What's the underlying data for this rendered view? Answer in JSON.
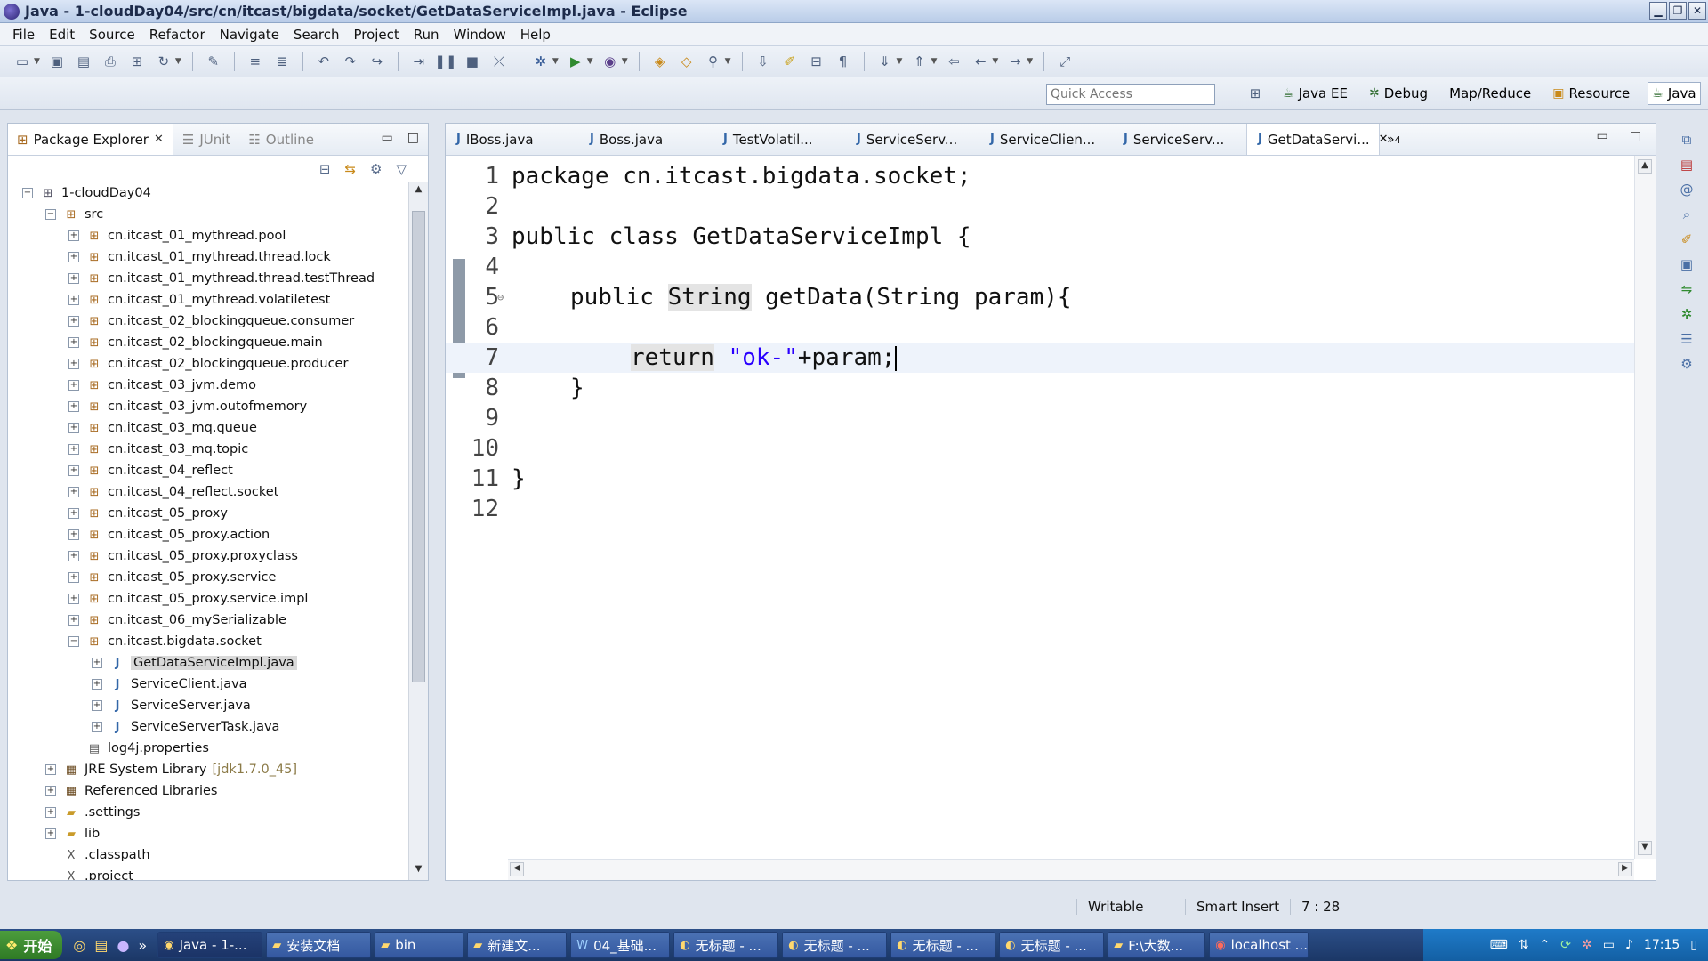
{
  "window": {
    "title": "Java - 1-cloudDay04/src/cn/itcast/bigdata/socket/GetDataServiceImpl.java - Eclipse"
  },
  "menu": [
    "File",
    "Edit",
    "Source",
    "Refactor",
    "Navigate",
    "Search",
    "Project",
    "Run",
    "Window",
    "Help"
  ],
  "quick_access": {
    "placeholder": "Quick Access"
  },
  "perspectives": [
    {
      "label": "Java EE",
      "icon": "java-ee-icon"
    },
    {
      "label": "Debug",
      "icon": "debug-icon"
    },
    {
      "label": "Map/Reduce",
      "icon": ""
    },
    {
      "label": "Resource",
      "icon": "resource-icon"
    },
    {
      "label": "Java",
      "icon": "java-perspective-icon",
      "active": true
    }
  ],
  "left_view": {
    "tabs": [
      "Package Explorer",
      "JUnit",
      "Outline"
    ],
    "tree": [
      {
        "label": "1-cloudDay04",
        "type": "project",
        "depth": 0,
        "expanded": true
      },
      {
        "label": "src",
        "type": "srcfolder",
        "depth": 1,
        "expanded": true
      },
      {
        "label": "cn.itcast_01_mythread.pool",
        "type": "package",
        "depth": 2
      },
      {
        "label": "cn.itcast_01_mythread.thread.lock",
        "type": "package",
        "depth": 2
      },
      {
        "label": "cn.itcast_01_mythread.thread.testThread",
        "type": "package",
        "depth": 2
      },
      {
        "label": "cn.itcast_01_mythread.volatiletest",
        "type": "package",
        "depth": 2
      },
      {
        "label": "cn.itcast_02_blockingqueue.consumer",
        "type": "package",
        "depth": 2
      },
      {
        "label": "cn.itcast_02_blockingqueue.main",
        "type": "package",
        "depth": 2
      },
      {
        "label": "cn.itcast_02_blockingqueue.producer",
        "type": "package",
        "depth": 2
      },
      {
        "label": "cn.itcast_03_jvm.demo",
        "type": "package",
        "depth": 2
      },
      {
        "label": "cn.itcast_03_jvm.outofmemory",
        "type": "package",
        "depth": 2
      },
      {
        "label": "cn.itcast_03_mq.queue",
        "type": "package",
        "depth": 2
      },
      {
        "label": "cn.itcast_03_mq.topic",
        "type": "package",
        "depth": 2
      },
      {
        "label": "cn.itcast_04_reflect",
        "type": "package",
        "depth": 2
      },
      {
        "label": "cn.itcast_04_reflect.socket",
        "type": "package",
        "depth": 2
      },
      {
        "label": "cn.itcast_05_proxy",
        "type": "package",
        "depth": 2
      },
      {
        "label": "cn.itcast_05_proxy.action",
        "type": "package",
        "depth": 2
      },
      {
        "label": "cn.itcast_05_proxy.proxyclass",
        "type": "package",
        "depth": 2
      },
      {
        "label": "cn.itcast_05_proxy.service",
        "type": "package",
        "depth": 2
      },
      {
        "label": "cn.itcast_05_proxy.service.impl",
        "type": "package",
        "depth": 2
      },
      {
        "label": "cn.itcast_06_mySerializable",
        "type": "package",
        "depth": 2
      },
      {
        "label": "cn.itcast.bigdata.socket",
        "type": "package",
        "depth": 2,
        "expanded": true
      },
      {
        "label": "GetDataServiceImpl.java",
        "type": "java",
        "depth": 3,
        "selected": true
      },
      {
        "label": "ServiceClient.java",
        "type": "java",
        "depth": 3
      },
      {
        "label": "ServiceServer.java",
        "type": "java",
        "depth": 3
      },
      {
        "label": "ServiceServerTask.java",
        "type": "java",
        "depth": 3
      },
      {
        "label": "log4j.properties",
        "type": "file",
        "depth": 2,
        "leaf": true
      },
      {
        "label": "JRE System Library",
        "suffix": "[jdk1.7.0_45]",
        "type": "lib",
        "depth": 1
      },
      {
        "label": "Referenced Libraries",
        "type": "lib",
        "depth": 1
      },
      {
        "label": ".settings",
        "type": "folder",
        "depth": 1
      },
      {
        "label": "lib",
        "type": "folder",
        "depth": 1
      },
      {
        "label": ".classpath",
        "type": "xfile",
        "depth": 1,
        "leaf": true
      },
      {
        "label": ".project",
        "type": "xfile",
        "depth": 1,
        "leaf": true
      }
    ]
  },
  "editor": {
    "tabs": [
      {
        "label": "IBoss.java"
      },
      {
        "label": "Boss.java"
      },
      {
        "label": "TestVolatil..."
      },
      {
        "label": "ServiceServ..."
      },
      {
        "label": "ServiceClien..."
      },
      {
        "label": "ServiceServ..."
      },
      {
        "label": "GetDataServi...",
        "active": true
      }
    ],
    "overflow_count": "4",
    "line_numbers": [
      "1",
      "2",
      "3",
      "4",
      "5",
      "6",
      "7",
      "8",
      "9",
      "10",
      "11",
      "12"
    ],
    "code": {
      "l1_kw": "package",
      "l1_rest": " cn.itcast.bigdata.socket;",
      "l3_kw": "public class",
      "l3_rest": " GetDataServiceImpl {",
      "l5_kw": "public",
      "l5_type": "String",
      "l5_rest": " getData(String param){",
      "l7_kw": "return",
      "l7_str": "\"ok-\"",
      "l7_rest": "+param;",
      "l8": "}",
      "l11": "}"
    },
    "current_line": 7
  },
  "status": {
    "writable": "Writable",
    "insert_mode": "Smart Insert",
    "position": "7 : 28"
  },
  "taskbar": {
    "start": "开始",
    "items": [
      "Java - 1-...",
      "安装文档",
      "bin",
      "新建文...",
      "04_基础...",
      "无标题 - ...",
      "无标题 - ...",
      "无标题 - ...",
      "无标题 - ...",
      "F:\\大数...",
      "localhost ..."
    ],
    "clock": "17:15"
  }
}
